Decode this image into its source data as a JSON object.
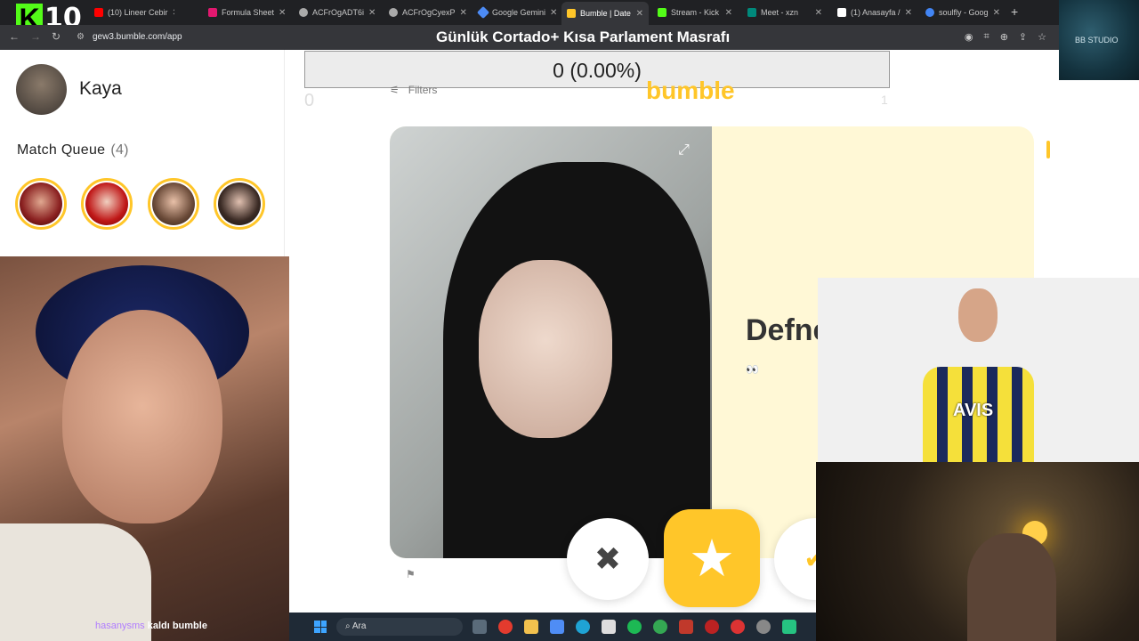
{
  "overlay": {
    "kick_count": "10",
    "banner": "Günlük Cortado+ Kısa Parlament Masrafı",
    "studio_label": "BB STUDIO"
  },
  "browser": {
    "tabs": [
      {
        "label": "(10)",
        "color": "#53fc18"
      },
      {
        "label": "(10) Lineer Cebir",
        "color": "#ff0000"
      },
      {
        "label": "Formula Sheet",
        "color": "#e2186f"
      },
      {
        "label": "ACFrOgADT6i",
        "color": "#aaaaaa"
      },
      {
        "label": "ACFrOgCyexP",
        "color": "#aaaaaa"
      },
      {
        "label": "Google Gemini",
        "color": "#4c8bf5"
      },
      {
        "label": "Bumble | Date",
        "color": "#ffc629"
      },
      {
        "label": "Stream - Kick",
        "color": "#53fc18"
      },
      {
        "label": "Meet - xzn",
        "color": "#00897b"
      },
      {
        "label": "(1) Anasayfa /",
        "color": "#ffffff"
      },
      {
        "label": "soulfly - Goog",
        "color": "#4285f4"
      }
    ],
    "url": "gew3.bumble.com/app"
  },
  "sidebar": {
    "user_name": "Kaya",
    "match_queue_label": "Match Queue",
    "match_queue_count": "(4)"
  },
  "main": {
    "stats": "0 (0.00%)",
    "filters_label": "Filters",
    "logo_text": "bumble",
    "ghost_left": "0",
    "ghost_right": "1",
    "profile_name": "Defne",
    "profile_emoji": "👀"
  },
  "actions": {
    "pass_icon": "close-icon",
    "superswipe_icon": "star-icon",
    "like_icon": "check-icon"
  },
  "stream": {
    "chat_user": "hasanysms",
    "chat_message": "kaldı bumble",
    "jersey_text": "AVIS"
  },
  "taskbar": {
    "search_placeholder": "Ara"
  },
  "colors": {
    "bumble_yellow": "#ffc629",
    "bumble_cream": "#fff8d6"
  }
}
